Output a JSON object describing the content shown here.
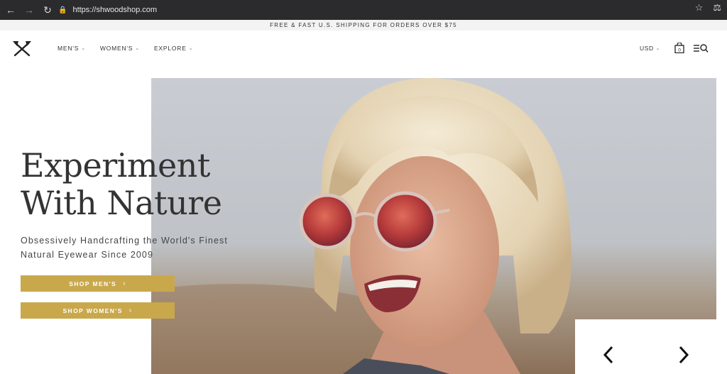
{
  "browser": {
    "url": "https://shwoodshop.com",
    "back_icon": "back-arrow-icon",
    "forward_icon": "forward-arrow-icon",
    "reload_icon": "reload-icon",
    "star_icon": "star-icon",
    "extension_icon": "extension-icon"
  },
  "promo": {
    "text": "FREE & FAST U.S. SHIPPING FOR ORDERS OVER $75"
  },
  "header": {
    "menu": [
      {
        "label": "MEN'S"
      },
      {
        "label": "WOMEN'S"
      },
      {
        "label": "EXPLORE"
      }
    ],
    "currency": "USD",
    "cart_count": "0"
  },
  "hero": {
    "headline_line1": "Experiment",
    "headline_line2": "With Nature",
    "subhead_line1": "Obsessively Handcrafting the World's Finest",
    "subhead_line2": "Natural Eyewear Since 2009",
    "cta_mens": "SHOP MEN'S",
    "cta_womens": "SHOP WOMEN'S"
  },
  "colors": {
    "accent": "#c9a84c",
    "chrome": "#2b2b2e",
    "text": "#333333"
  }
}
